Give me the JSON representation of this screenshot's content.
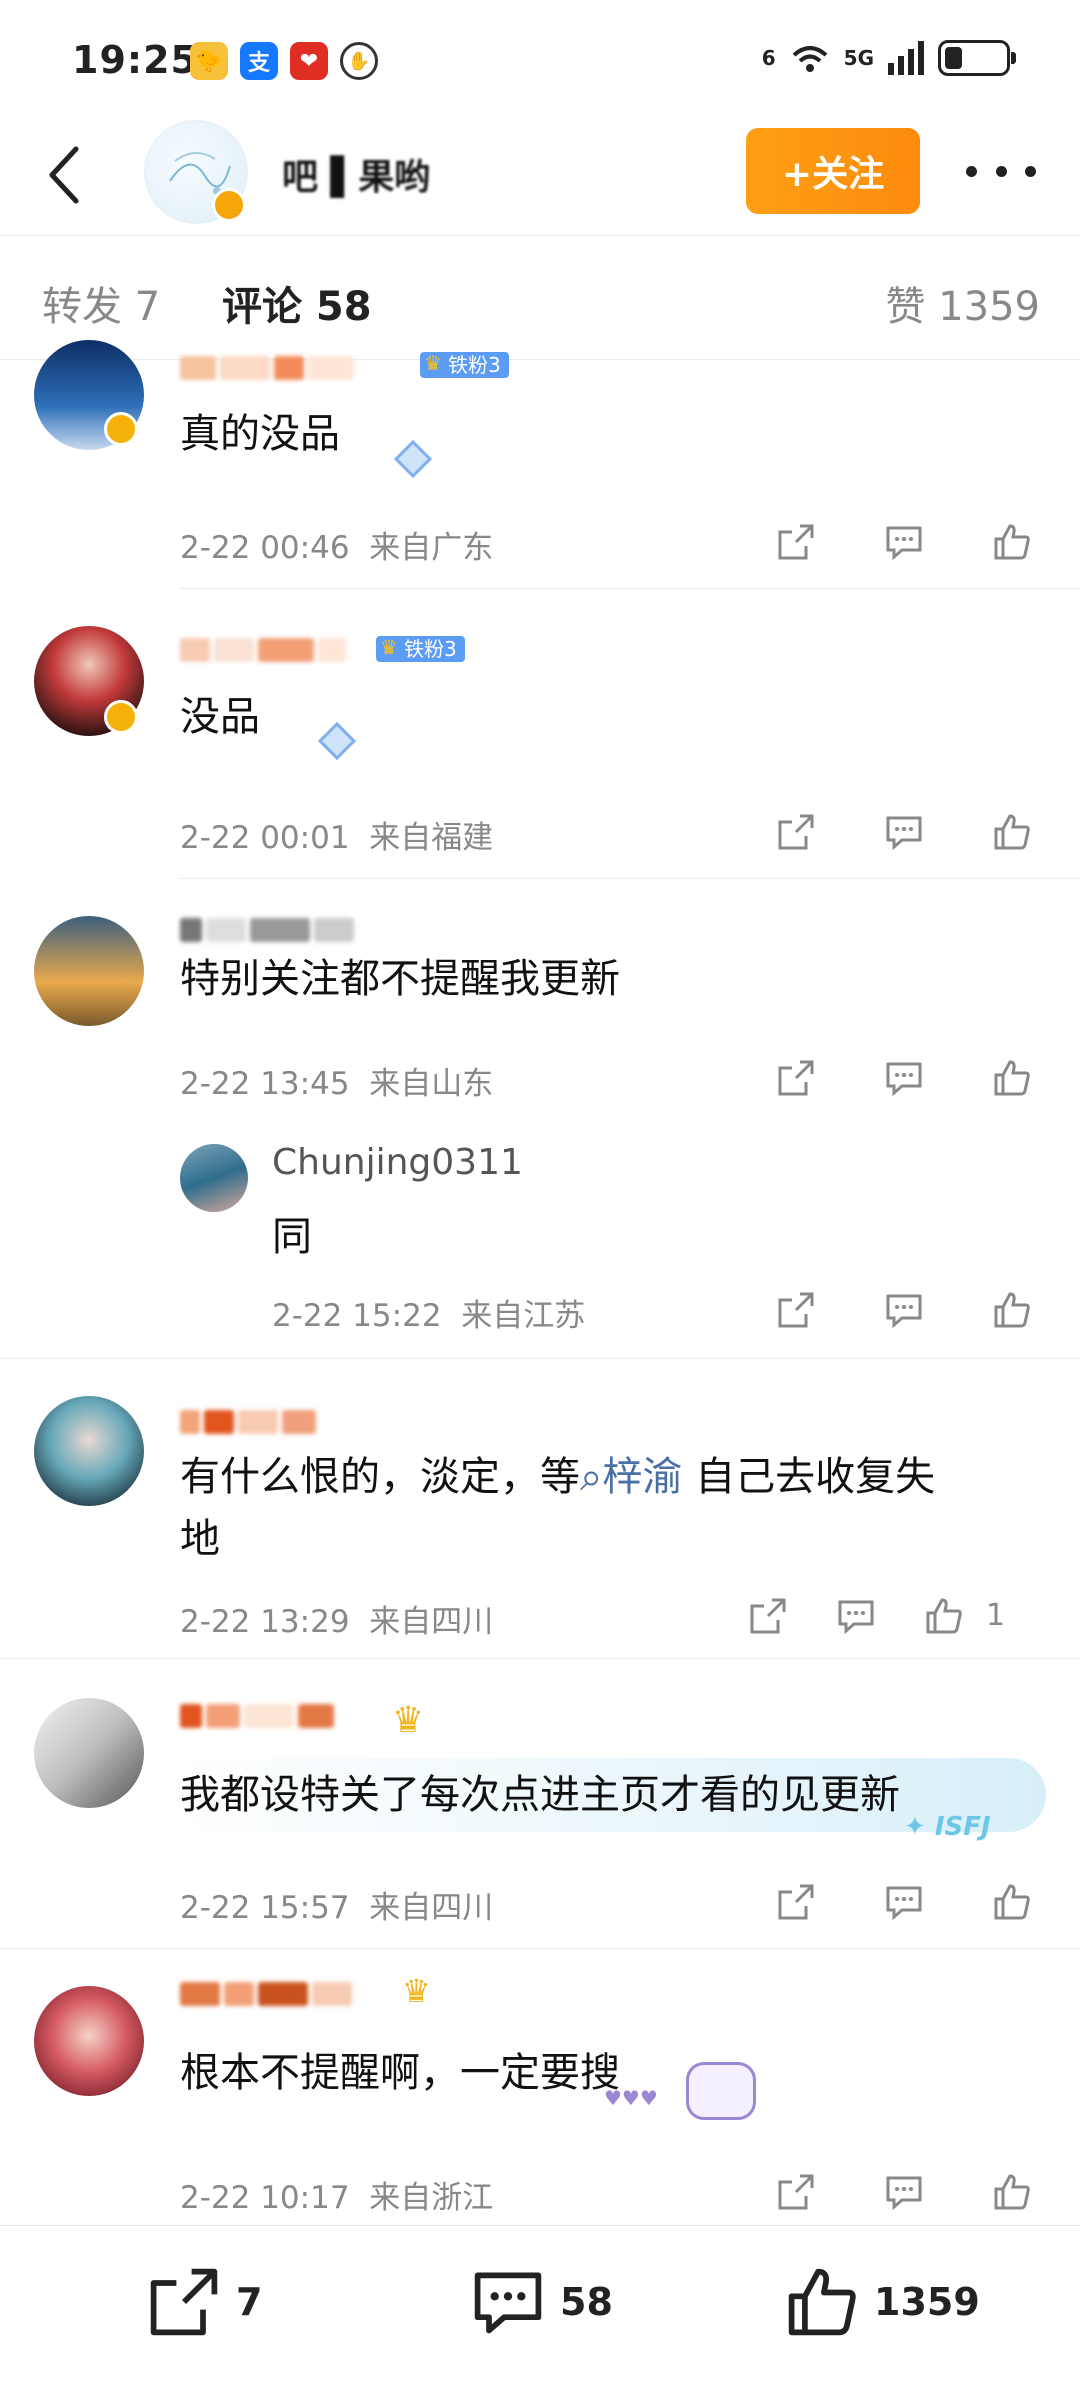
{
  "status_bar": {
    "time": "19:25",
    "signal_labels": [
      "6",
      "5G"
    ],
    "battery_level": 0.3
  },
  "header": {
    "account_name": "吧 ▌果哟",
    "follow_label": "+关注"
  },
  "tabs": {
    "repost": "转发 7",
    "comments": "评论 58",
    "likes": "赞 1359"
  },
  "comments": [
    {
      "text": "真的没品",
      "time": "2-22 00:46",
      "location": "来自广东",
      "fan_badge": "铁粉3",
      "like_count": ""
    },
    {
      "text": "没品",
      "time": "2-22 00:01",
      "location": "来自福建",
      "fan_badge": "铁粉3",
      "like_count": ""
    },
    {
      "text": "特别关注都不提醒我更新",
      "time": "2-22 13:45",
      "location": "来自山东",
      "like_count": "",
      "reply": {
        "name": "Chunjing0311",
        "text": "同",
        "time": "2-22 15:22",
        "location": "来自江苏"
      }
    },
    {
      "text_before": "有什么恨的，淡定，等",
      "topic": "梓渝",
      "text_after": "自己去收复失",
      "text_line2": "地",
      "time": "2-22 13:29",
      "location": "来自四川",
      "like_count": "1"
    },
    {
      "text": "我都设特关了每次点进主页才看的见更新",
      "time": "2-22 15:57",
      "location": "来自四川",
      "like_count": ""
    },
    {
      "text": "根本不提醒啊，一定要搜",
      "time": "2-22 10:17",
      "location": "来自浙江",
      "like_count": ""
    }
  ],
  "bottom_bar": {
    "repost_count": "7",
    "comment_count": "58",
    "like_count": "1359"
  },
  "colors": {
    "accent_orange": "#fd8b0c",
    "topic_blue": "#4a6fa5",
    "verified_gold": "#f6b10a",
    "fan_badge_blue": "#5b9df5"
  }
}
